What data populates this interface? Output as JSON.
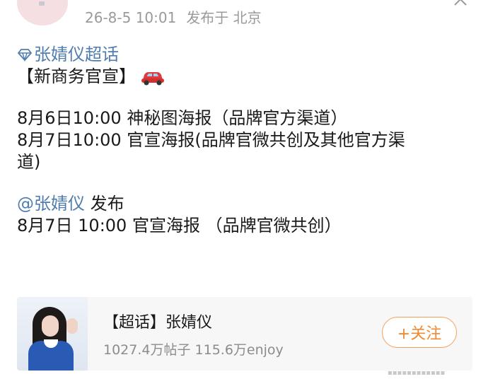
{
  "post": {
    "time": "26-8-5 10:01",
    "location": "发布于 北京",
    "topic": "张婧仪超话",
    "heading": "【新商务官宣】",
    "schedule": [
      "8月6日10:00 神秘图海报（品牌官方渠道）",
      "8月7日10:00 官宣海报(品牌官微共创及其他官方渠",
      "道)"
    ],
    "mention": "@张婧仪",
    "mention_suffix": " 发布",
    "mention_line": "8月7日 10:00 官宣海报 （品牌官微共创）"
  },
  "card": {
    "title": "【超话】张婧仪",
    "stats": "1027.4万帖子 115.6万enjoy",
    "follow_label": "+关注"
  },
  "colors": {
    "link": "#507daf",
    "accent": "#ef8a33",
    "muted": "#9a9a9a"
  },
  "icons": [
    "diamond-icon",
    "car-icon",
    "close-icon"
  ]
}
